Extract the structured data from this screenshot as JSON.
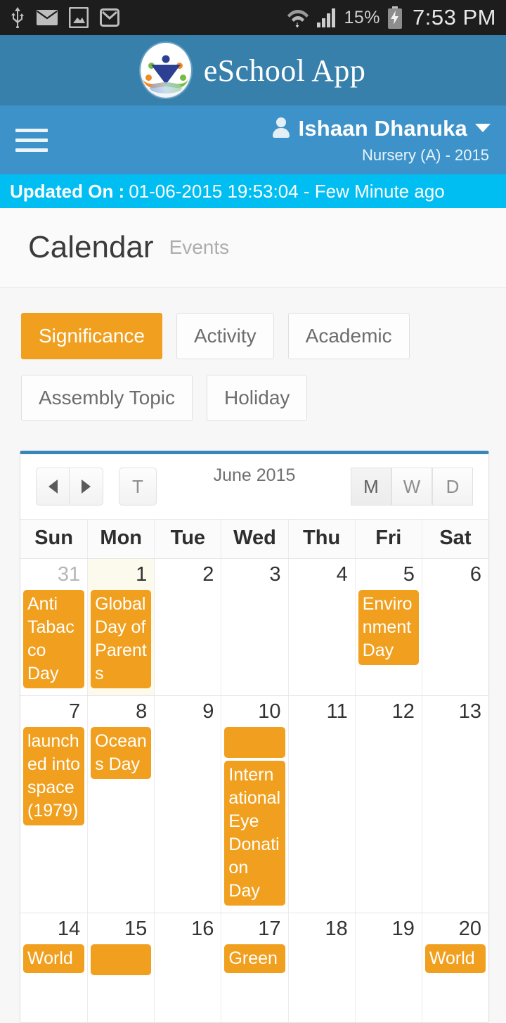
{
  "statusbar": {
    "icons": [
      "usb-icon",
      "email-icon",
      "photo-icon",
      "gmail-icon"
    ],
    "wifi_icon": "wifi-data-icon",
    "signal_icon": "cellular-signal-icon",
    "battery_percent": "15%",
    "battery_icon": "battery-charging-icon",
    "time": "7:53 PM"
  },
  "appbar": {
    "logo": "eschool-logo-icon",
    "title": "eSchool App"
  },
  "navbar": {
    "menu_icon": "hamburger-menu-icon",
    "user_icon": "user-avatar-icon",
    "user_name": "Ishaan Dhanuka",
    "caret_icon": "chevron-down-icon",
    "user_class": "Nursery (A) - 2015"
  },
  "updated": {
    "label": "Updated On :",
    "value": "01-06-2015 19:53:04 - Few Minute ago"
  },
  "page": {
    "title": "Calendar",
    "subtitle": "Events"
  },
  "filters": [
    {
      "label": "Significance",
      "active": true
    },
    {
      "label": "Activity",
      "active": false
    },
    {
      "label": "Academic",
      "active": false
    },
    {
      "label": "Assembly Topic",
      "active": false
    },
    {
      "label": "Holiday",
      "active": false
    }
  ],
  "calendar": {
    "prev_label": "prev-arrow-icon",
    "next_label": "next-arrow-icon",
    "today_label": "T",
    "month_label": "June 2015",
    "views": [
      {
        "label": "M",
        "selected": true
      },
      {
        "label": "W",
        "selected": false
      },
      {
        "label": "D",
        "selected": false
      }
    ],
    "day_headers": [
      "Sun",
      "Mon",
      "Tue",
      "Wed",
      "Thu",
      "Fri",
      "Sat"
    ],
    "weeks": [
      [
        {
          "num": "31",
          "other": true,
          "today": false,
          "events": [
            "Anti Tabacco Day"
          ]
        },
        {
          "num": "1",
          "other": false,
          "today": true,
          "events": [
            "Global Day of Parents"
          ]
        },
        {
          "num": "2",
          "other": false,
          "today": false,
          "events": []
        },
        {
          "num": "3",
          "other": false,
          "today": false,
          "events": []
        },
        {
          "num": "4",
          "other": false,
          "today": false,
          "events": []
        },
        {
          "num": "5",
          "other": false,
          "today": false,
          "events": [
            "Environment Day"
          ]
        },
        {
          "num": "6",
          "other": false,
          "today": false,
          "events": []
        }
      ],
      [
        {
          "num": "7",
          "other": false,
          "today": false,
          "events": [
            "launched into space (1979)"
          ]
        },
        {
          "num": "8",
          "other": false,
          "today": false,
          "events": [
            "Oceans Day"
          ]
        },
        {
          "num": "9",
          "other": false,
          "today": false,
          "events": []
        },
        {
          "num": "10",
          "other": false,
          "today": false,
          "events": [
            "",
            "International Eye Donation Day"
          ]
        },
        {
          "num": "11",
          "other": false,
          "today": false,
          "events": []
        },
        {
          "num": "12",
          "other": false,
          "today": false,
          "events": []
        },
        {
          "num": "13",
          "other": false,
          "today": false,
          "events": []
        }
      ],
      [
        {
          "num": "14",
          "other": false,
          "today": false,
          "events": [
            "World"
          ]
        },
        {
          "num": "15",
          "other": false,
          "today": false,
          "events": [
            ""
          ]
        },
        {
          "num": "16",
          "other": false,
          "today": false,
          "events": []
        },
        {
          "num": "17",
          "other": false,
          "today": false,
          "events": [
            "Green"
          ]
        },
        {
          "num": "18",
          "other": false,
          "today": false,
          "events": []
        },
        {
          "num": "19",
          "other": false,
          "today": false,
          "events": []
        },
        {
          "num": "20",
          "other": false,
          "today": false,
          "events": [
            "World"
          ]
        }
      ]
    ]
  },
  "colors": {
    "appbar": "#3780ac",
    "navbar": "#3d93c9",
    "updated_bar": "#00bdf2",
    "accent_orange": "#f0a01e",
    "panel_top_border": "#3a86b8"
  }
}
